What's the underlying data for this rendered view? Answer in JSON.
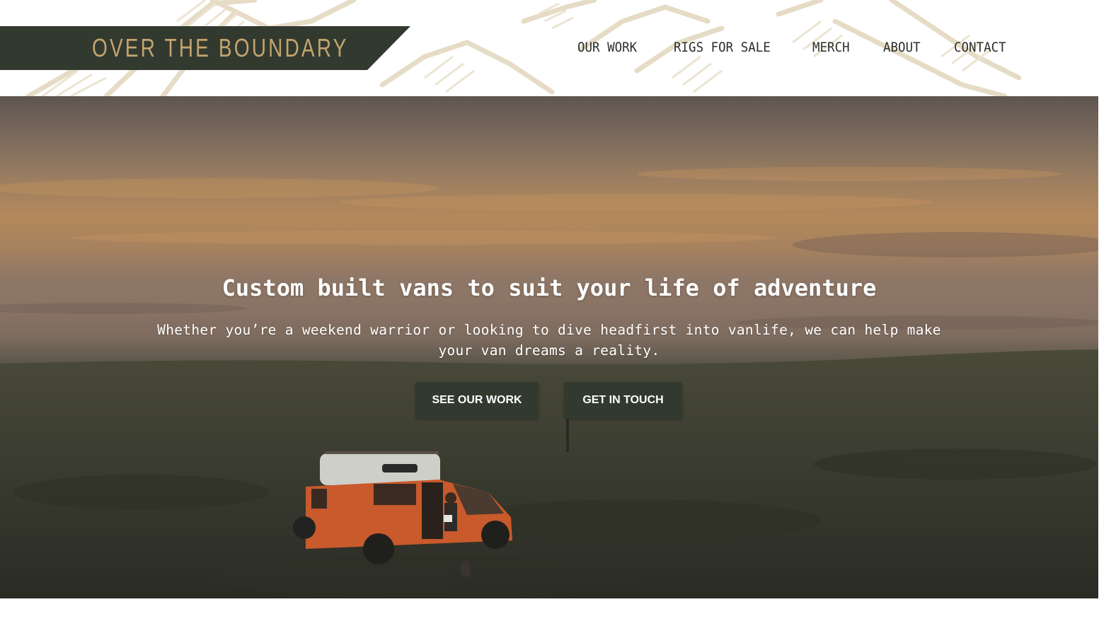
{
  "brand": {
    "name": "OVER THE BOUNDARY",
    "banner_color": "#323a30",
    "text_color": "#c4a46f"
  },
  "nav": {
    "items": [
      {
        "label": "OUR WORK"
      },
      {
        "label": "RIGS FOR SALE"
      },
      {
        "label": "MERCH"
      },
      {
        "label": "ABOUT"
      },
      {
        "label": "CONTACT"
      }
    ]
  },
  "hero": {
    "title": "Custom built vans to suit your life of adventure",
    "subtitle": "Whether you’re a weekend warrior or looking to dive headfirst into vanlife, we can help make your van dreams a reality.",
    "buttons": [
      {
        "label": "SEE OUR WORK"
      },
      {
        "label": "GET IN TOUCH"
      }
    ],
    "button_color": "#323a30"
  },
  "colors": {
    "mountain_art": "#e6dcc6",
    "van_body": "#c85a2b"
  }
}
